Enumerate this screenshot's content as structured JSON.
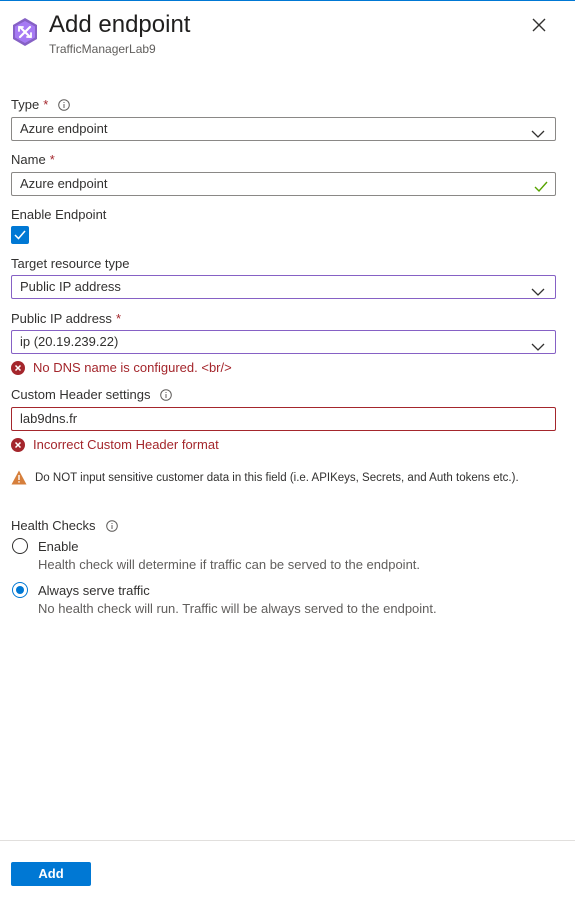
{
  "header": {
    "title": "Add endpoint",
    "subtitle": "TrafficManagerLab9",
    "icon": "traffic-manager-icon"
  },
  "form": {
    "type": {
      "label": "Type",
      "required": "*",
      "value": "Azure endpoint"
    },
    "name": {
      "label": "Name",
      "required": "*",
      "value": "Azure endpoint"
    },
    "enable_endpoint": {
      "label": "Enable Endpoint",
      "checked": true
    },
    "target_resource_type": {
      "label": "Target resource type",
      "value": "Public IP address"
    },
    "public_ip": {
      "label": "Public IP address",
      "required": "*",
      "value": "ip (20.19.239.22)",
      "error": "No DNS name is configured. <br/>"
    },
    "custom_header": {
      "label": "Custom Header settings",
      "value": "lab9dns.fr",
      "error": "Incorrect Custom Header format"
    },
    "warning": "Do NOT input sensitive customer data in this field (i.e. APIKeys, Secrets, and Auth tokens etc.).",
    "health_checks": {
      "label": "Health Checks",
      "options": [
        {
          "label": "Enable",
          "description": "Health check will determine if traffic can be served to the endpoint.",
          "selected": false
        },
        {
          "label": "Always serve traffic",
          "description": "No health check will run. Traffic will be always served to the endpoint.",
          "selected": true
        }
      ]
    }
  },
  "footer": {
    "add_label": "Add"
  },
  "colors": {
    "accent": "#0078d4",
    "error": "#a4262c",
    "warning": "#d67f3c",
    "success": "#57a300"
  }
}
